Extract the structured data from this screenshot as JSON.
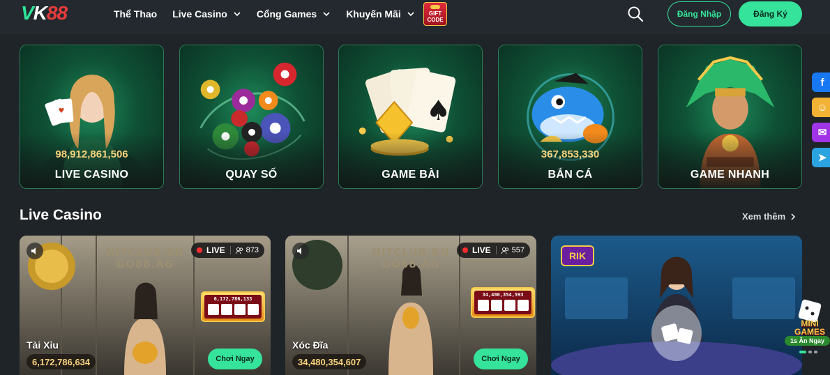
{
  "header": {
    "logo": {
      "v": "V",
      "k": "K",
      "n": "88"
    },
    "nav": [
      {
        "label": "Thể Thao",
        "dropdown": false
      },
      {
        "label": "Live Casino",
        "dropdown": true
      },
      {
        "label": "Cổng Games",
        "dropdown": true
      },
      {
        "label": "Khuyến Mãi",
        "dropdown": true
      }
    ],
    "gift": {
      "line1": "GIFT",
      "line2": "CODE"
    },
    "login_label": "Đăng Nhập",
    "register_label": "Đăng Ký"
  },
  "categories": [
    {
      "label": "LIVE CASINO",
      "amount": "98,912,861,506"
    },
    {
      "label": "QUAY SỐ",
      "amount": ""
    },
    {
      "label": "GAME BÀI",
      "amount": ""
    },
    {
      "label": "BẮN CÁ",
      "amount": "367,853,330"
    },
    {
      "label": "GAME NHANH",
      "amount": ""
    }
  ],
  "social": [
    {
      "icon": "facebook-icon",
      "color": "#1877f2",
      "glyph": "f"
    },
    {
      "icon": "group-icon",
      "color": "#f2b233",
      "glyph": "☺"
    },
    {
      "icon": "messenger-icon",
      "color": "#a034e6",
      "glyph": "✉"
    },
    {
      "icon": "telegram-icon",
      "color": "#2aa3e0",
      "glyph": "➤"
    }
  ],
  "section": {
    "title": "Live Casino",
    "see_more": "Xem thêm"
  },
  "games": [
    {
      "name": "Tài Xỉu",
      "jackpot": "6,172,786,634",
      "live": "LIVE",
      "viewers": "873",
      "brand_line1": "HITCLUB.BH",
      "brand_line2": "GO88.AG",
      "board": "6,172,786,133",
      "play_label": "Chơi Ngay"
    },
    {
      "name": "Xóc Đĩa",
      "jackpot": "34,480,354,607",
      "live": "LIVE",
      "viewers": "557",
      "brand_line1": "HITCLUB.BH",
      "brand_line2": "GO88.AG",
      "board": "34,480,354,593",
      "play_label": "Chơi Ngay"
    }
  ],
  "promo": {
    "sign": "RIK",
    "mini_line1": "MINI",
    "mini_line2": "GAMES",
    "mini_line3": "1s Ăn Ngay"
  },
  "colors": {
    "accent": "#35e39b",
    "gold": "#f7d27c",
    "bg": "#1f2428"
  }
}
